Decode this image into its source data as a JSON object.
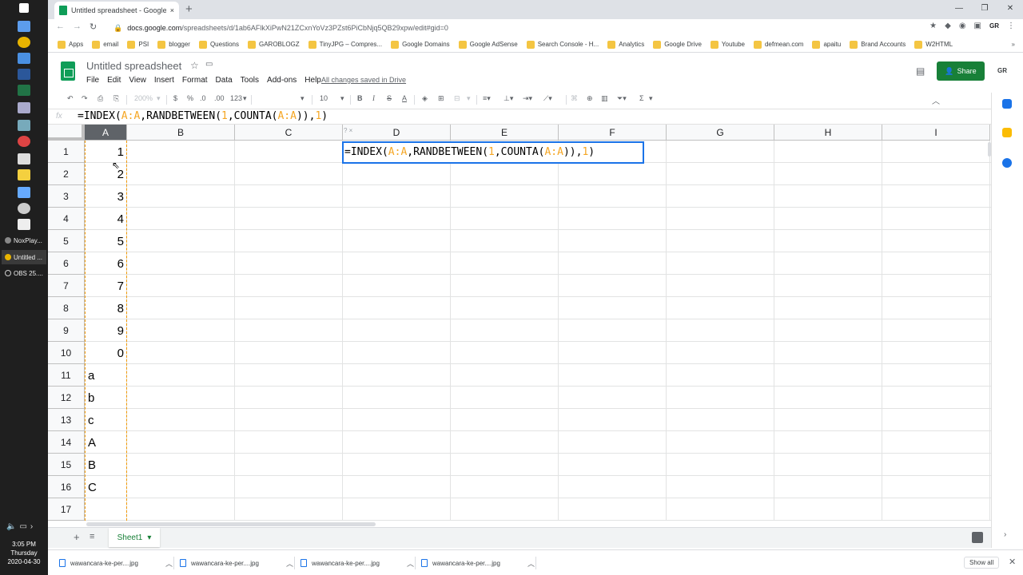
{
  "browser": {
    "tab_title": "Untitled spreadsheet - Google Sh",
    "close_tab": "×",
    "new_tab": "+",
    "url_host": "docs.google.com",
    "url_path": "/spreadsheets/d/1ab6AFlkXiPwN21ZCxnYoVz3PZst6PiCbNjq5QB29xpw/edit#gid=0",
    "window_controls": [
      "—",
      "❐",
      "✕"
    ],
    "account": "GR",
    "bookmarks": [
      "Apps",
      "email",
      "PSI",
      "blogger",
      "Questions",
      "GAROBLOGZ",
      "TinyJPG – Compres...",
      "Google Domains",
      "Google AdSense",
      "Search Console - H...",
      "Analytics",
      "Google Drive",
      "Youtube",
      "defmean.com",
      "apaitu",
      "Brand Accounts",
      "W2HTML"
    ],
    "bookmarks_more": "»"
  },
  "sheets": {
    "title": "Untitled spreadsheet",
    "menu": [
      "File",
      "Edit",
      "View",
      "Insert",
      "Format",
      "Data",
      "Tools",
      "Add-ons",
      "Help"
    ],
    "saved_status": "All changes saved in Drive",
    "share_label": "Share",
    "account": "GR"
  },
  "toolbar": {
    "zoom": "200%",
    "currency": "$",
    "percent": "%",
    "dec_decrease": ".0",
    "dec_increase": ".00",
    "more_formats": "123",
    "font_size": "10",
    "bold": "B",
    "italic": "I",
    "strike": "S",
    "text_color": "A",
    "sum": "Σ"
  },
  "formula_bar": {
    "fx": "fx",
    "parts": [
      {
        "t": "=INDEX(",
        "c": "plain"
      },
      {
        "t": "A:A",
        "c": "ref"
      },
      {
        "t": ",RANDBETWEEN(",
        "c": "plain"
      },
      {
        "t": "1",
        "c": "ref"
      },
      {
        "t": ",COUNTA(",
        "c": "plain"
      },
      {
        "t": "A:A",
        "c": "ref"
      },
      {
        "t": ")),",
        "c": "plain"
      },
      {
        "t": "1",
        "c": "ref"
      },
      {
        "t": ")",
        "c": "plain"
      }
    ]
  },
  "grid": {
    "columns": [
      "A",
      "B",
      "C",
      "D",
      "E",
      "F",
      "G",
      "H",
      "I"
    ],
    "selected_column": "A",
    "rows": [
      "1",
      "2",
      "3",
      "4",
      "5",
      "6",
      "7",
      "8",
      "9",
      "10",
      "11",
      "12",
      "13",
      "14",
      "15",
      "16",
      "17"
    ],
    "column_a": [
      {
        "v": "1",
        "type": "num"
      },
      {
        "v": "2",
        "type": "num"
      },
      {
        "v": "3",
        "type": "num"
      },
      {
        "v": "4",
        "type": "num"
      },
      {
        "v": "5",
        "type": "num"
      },
      {
        "v": "6",
        "type": "num"
      },
      {
        "v": "7",
        "type": "num"
      },
      {
        "v": "8",
        "type": "num"
      },
      {
        "v": "9",
        "type": "num"
      },
      {
        "v": "0",
        "type": "num"
      },
      {
        "v": "a",
        "type": "txt"
      },
      {
        "v": "b",
        "type": "txt"
      },
      {
        "v": "c",
        "type": "txt"
      },
      {
        "v": "A",
        "type": "txt"
      },
      {
        "v": "B",
        "type": "txt"
      },
      {
        "v": "C",
        "type": "txt"
      },
      {
        "v": "",
        "type": "txt"
      }
    ],
    "edit_hint": "? ×"
  },
  "sheet_tabs": {
    "add": "+",
    "all": "≡",
    "active": "Sheet1"
  },
  "downloads": {
    "items": [
      "wawancara-ke-per....jpg",
      "wawancara-ke-per....jpg",
      "wawancara-ke-per....jpg",
      "wawancara-ke-per....jpg"
    ],
    "show_all": "Show all",
    "close": "✕"
  },
  "taskbar": {
    "apps": [
      "NoxPlay...",
      "Untitled ...",
      "OBS 25...."
    ],
    "time": "3:05 PM",
    "day": "Thursday",
    "date": "2020-04-30"
  },
  "colors": {
    "accent": "#1a73e8",
    "share_green": "#188038",
    "ref_orange": "#f5a623",
    "marquee": "#f29900"
  }
}
